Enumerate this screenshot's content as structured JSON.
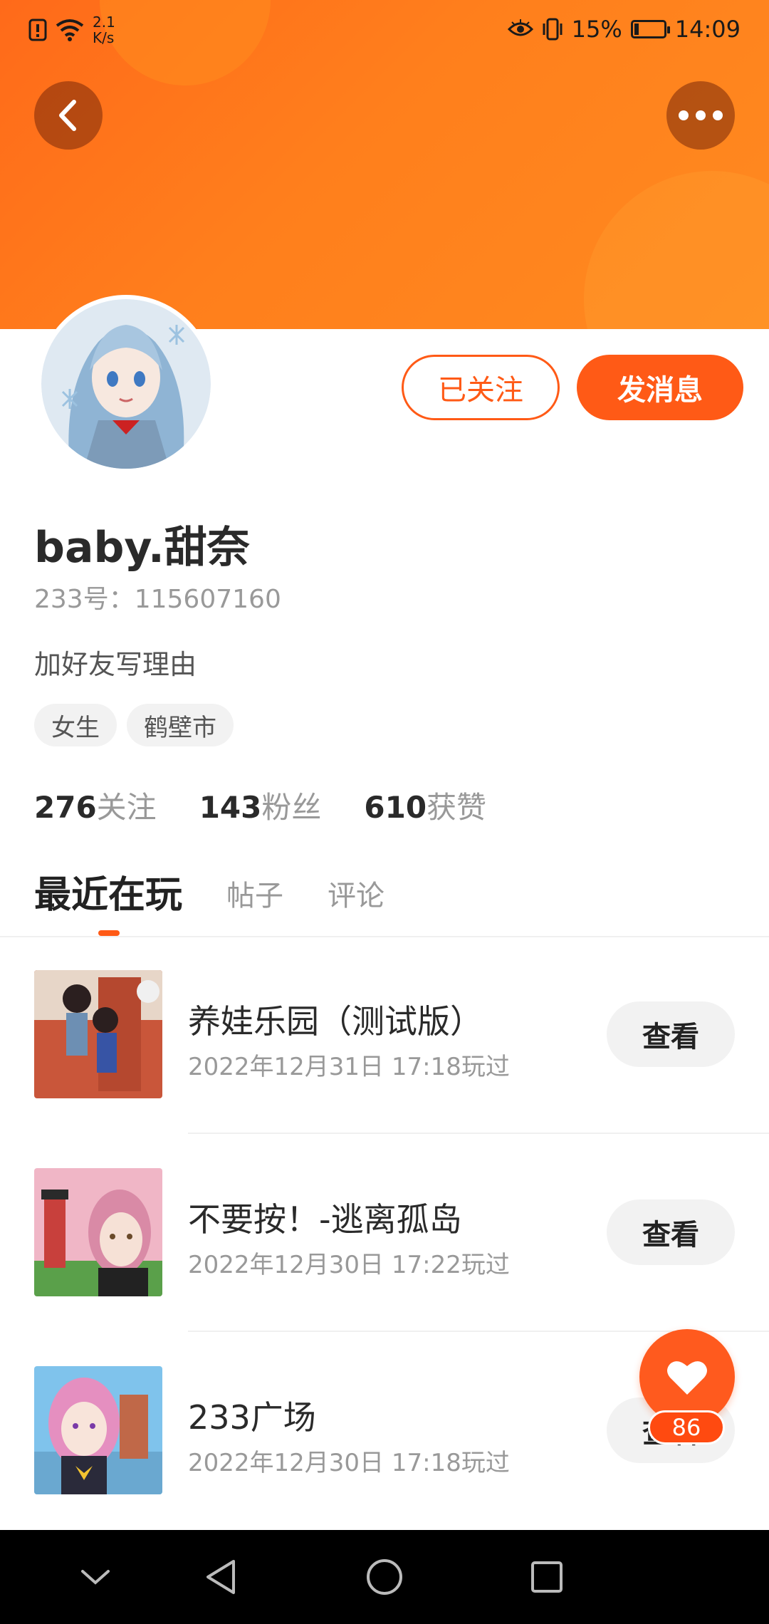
{
  "status_bar": {
    "net_speed_value": "2.1",
    "net_speed_unit": "K/s",
    "battery": "15%",
    "time": "14:09",
    "battery_level": 0.15
  },
  "header": {
    "accent_color": "#ff5a16",
    "back_icon": "chevron-left-icon",
    "more_icon": "more-horizontal-icon"
  },
  "profile": {
    "followed_label": "已关注",
    "message_label": "发消息",
    "username": "baby.甜奈",
    "account_id": "233号：115607160",
    "bio": "加好友写理由",
    "tags": [
      "女生",
      "鹤壁市"
    ],
    "stats": [
      {
        "num": "276",
        "label": "关注"
      },
      {
        "num": "143",
        "label": "粉丝"
      },
      {
        "num": "610",
        "label": "获赞"
      }
    ]
  },
  "tabs": [
    "最近在玩",
    "帖子",
    "评论"
  ],
  "games": [
    {
      "name": "养娃乐园（测试版）",
      "time": "2022年12月31日 17:18玩过",
      "action": "查看"
    },
    {
      "name": "不要按！-逃离孤岛",
      "time": "2022年12月30日 17:22玩过",
      "action": "查看"
    },
    {
      "name": "233广场",
      "time": "2022年12月30日 17:18玩过",
      "action": "查看"
    }
  ],
  "like_fab": {
    "count": "86",
    "icon": "heart-icon"
  },
  "nav_bar": {
    "icons": [
      "chevron-down-icon",
      "back-triangle-icon",
      "home-circle-icon",
      "recents-square-icon"
    ]
  }
}
